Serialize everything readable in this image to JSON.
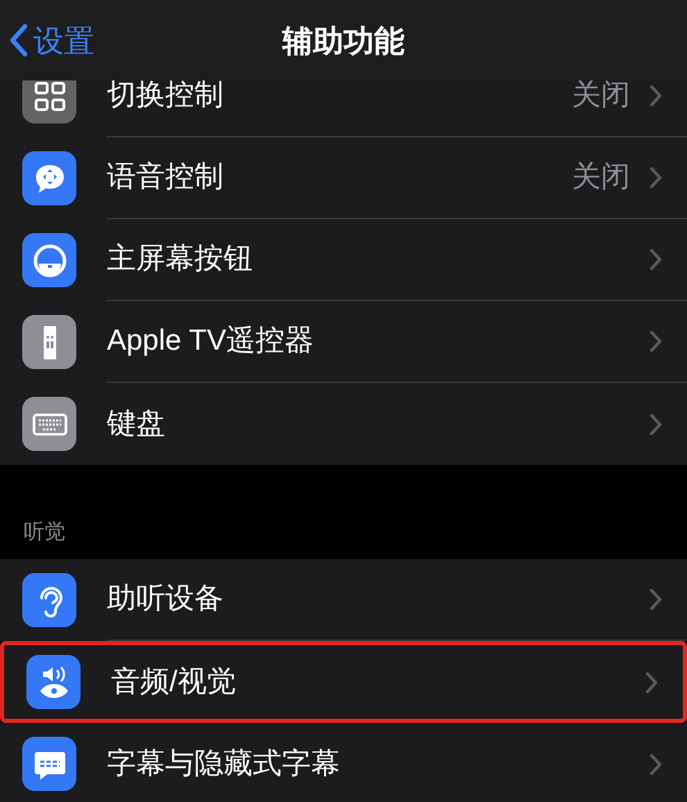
{
  "nav": {
    "back": "设置",
    "title": "辅助功能"
  },
  "sections": [
    {
      "items": [
        {
          "label": "切换控制",
          "value": "关闭",
          "kind": "switch",
          "color": "#636366",
          "highlighted": false
        },
        {
          "label": "语音控制",
          "value": "关闭",
          "kind": "voice",
          "color": "#3478f6",
          "highlighted": false
        },
        {
          "label": "主屏幕按钮",
          "kind": "home",
          "color": "#3478f6",
          "highlighted": false
        },
        {
          "label": "Apple TV遥控器",
          "kind": "remote",
          "color": "#8e8e93",
          "highlighted": false
        },
        {
          "label": "键盘",
          "kind": "keyboard",
          "color": "#8e8e93",
          "highlighted": false
        }
      ]
    },
    {
      "header": "听觉",
      "items": [
        {
          "label": "助听设备",
          "kind": "ear",
          "color": "#3478f6",
          "highlighted": false
        },
        {
          "label": "音频/视觉",
          "kind": "audio",
          "color": "#3478f6",
          "highlighted": true
        },
        {
          "label": "字幕与隐藏式字幕",
          "kind": "captions",
          "color": "#3478f6",
          "highlighted": false
        }
      ]
    }
  ]
}
